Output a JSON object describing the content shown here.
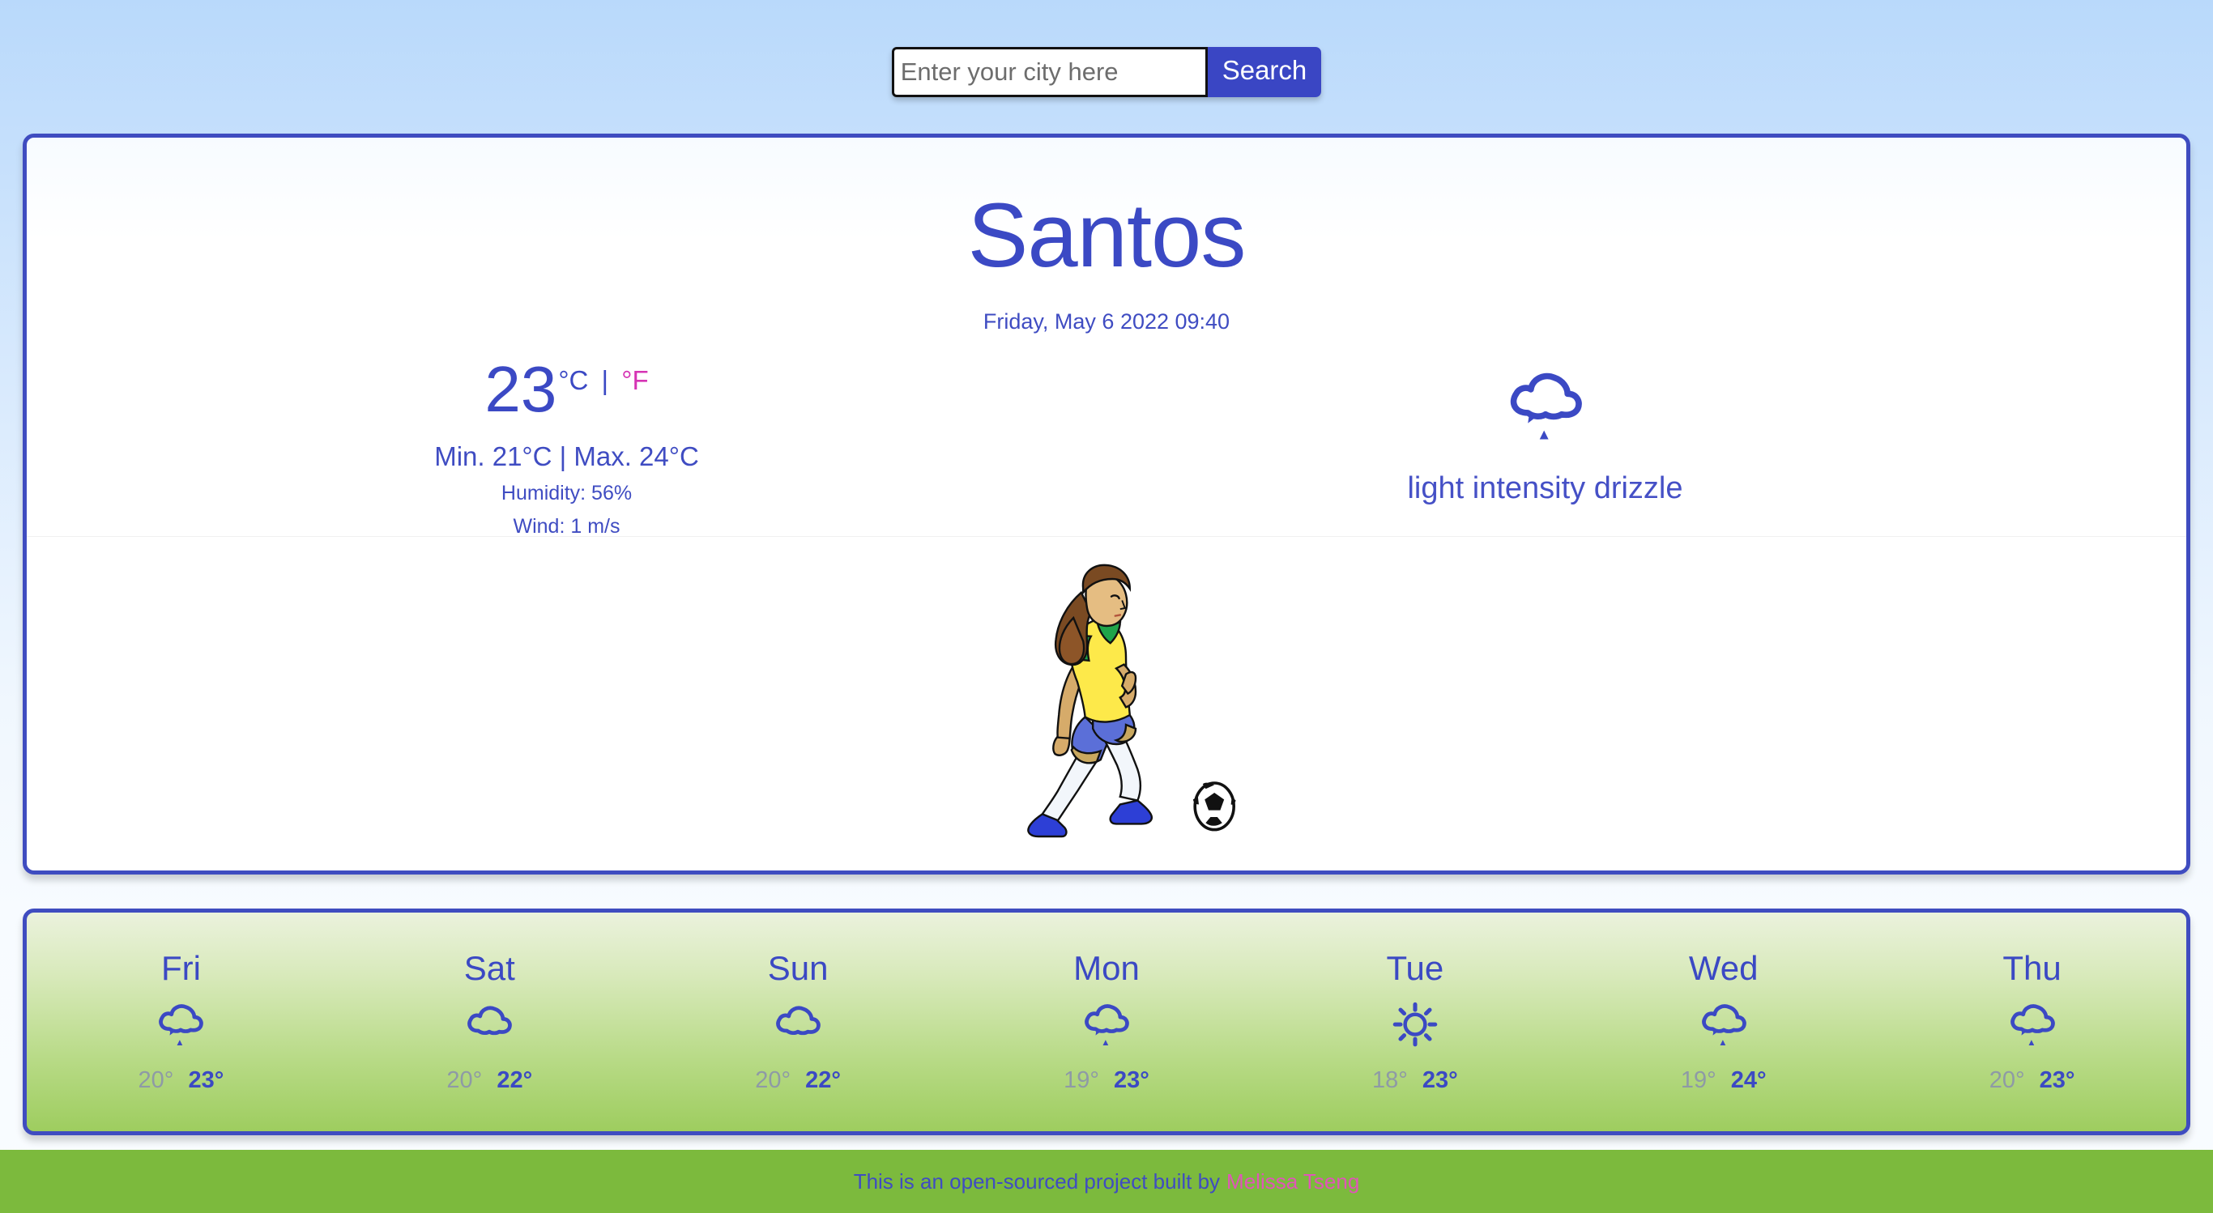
{
  "search": {
    "placeholder": "Enter your city here",
    "value": "",
    "button_label": "Search"
  },
  "current": {
    "city": "Santos",
    "datetime": "Friday, May 6 2022 09:40",
    "temperature": "23",
    "unit_celsius": "°C",
    "unit_separator": "|",
    "unit_fahrenheit": "°F",
    "active_unit": "celsius",
    "minmax": "Min. 21°C | Max. 24°C",
    "humidity": "Humidity: 56%",
    "wind": "Wind: 1 m/s",
    "description": "light intensity drizzle",
    "icon": "drizzle-cloud-icon",
    "illustration": "soccer-player-with-ball-illustration"
  },
  "forecast": [
    {
      "day": "Fri",
      "icon": "drizzle-cloud-icon",
      "min": "20°",
      "max": "23°"
    },
    {
      "day": "Sat",
      "icon": "cloud-icon",
      "min": "20°",
      "max": "22°"
    },
    {
      "day": "Sun",
      "icon": "cloud-icon",
      "min": "20°",
      "max": "22°"
    },
    {
      "day": "Mon",
      "icon": "drizzle-cloud-icon",
      "min": "19°",
      "max": "23°"
    },
    {
      "day": "Tue",
      "icon": "sun-icon",
      "min": "18°",
      "max": "23°"
    },
    {
      "day": "Wed",
      "icon": "drizzle-cloud-icon",
      "min": "19°",
      "max": "24°"
    },
    {
      "day": "Thu",
      "icon": "drizzle-cloud-icon",
      "min": "20°",
      "max": "23°"
    }
  ],
  "footer": {
    "text": "This is an open-sourced project built by",
    "author": "Melissa Tseng"
  },
  "colors": {
    "primary_blue": "#3b49c4",
    "accent_pink": "#d634b4",
    "footer_green": "#7cba3d",
    "muted_gray": "#8e9aa6"
  }
}
